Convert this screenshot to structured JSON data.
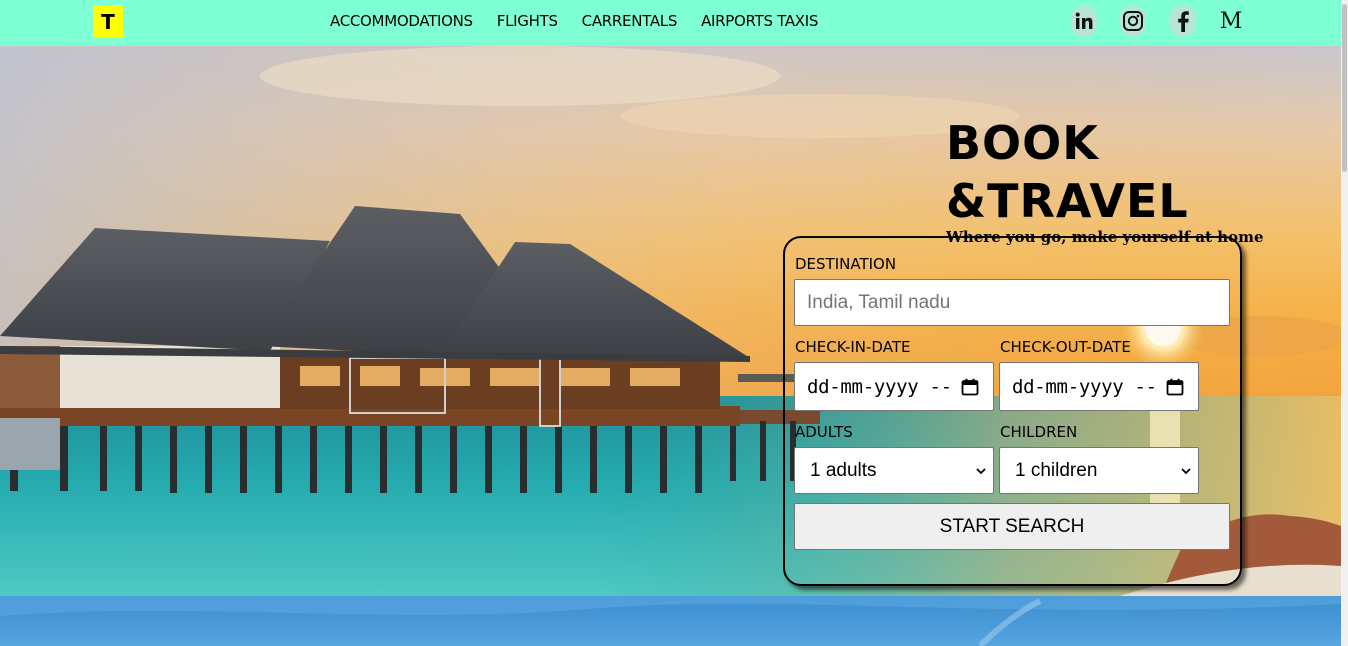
{
  "nav": {
    "logo": "T",
    "links": [
      "ACCOMMODATIONS",
      "FLIGHTS",
      "CARRENTALS",
      "AIRPORTS TAXIS"
    ],
    "social_medium": "M"
  },
  "hero": {
    "title_line1": "BOOK",
    "title_line2": "&TRAVEL",
    "tagline": "Where you go, make yourself at home"
  },
  "form": {
    "destination_label": "DESTINATION",
    "destination_placeholder": "India, Tamil nadu",
    "checkin_label": "CHECK-IN-DATE",
    "checkin_value": "dd-mm-yyyy --",
    "checkout_label": "CHECK-OUT-DATE",
    "checkout_value": "dd-mm-yyyy --",
    "adults_label": "ADULTS",
    "adults_value": "1 adults",
    "children_label": "CHILDREN",
    "children_value": "1 children",
    "search_button": "START SEARCH"
  },
  "colors": {
    "navbar": "#7fffd4",
    "logo_bg": "#ffff00",
    "sea": "#2aa6a6",
    "sky_warm": "#f5b44a"
  }
}
